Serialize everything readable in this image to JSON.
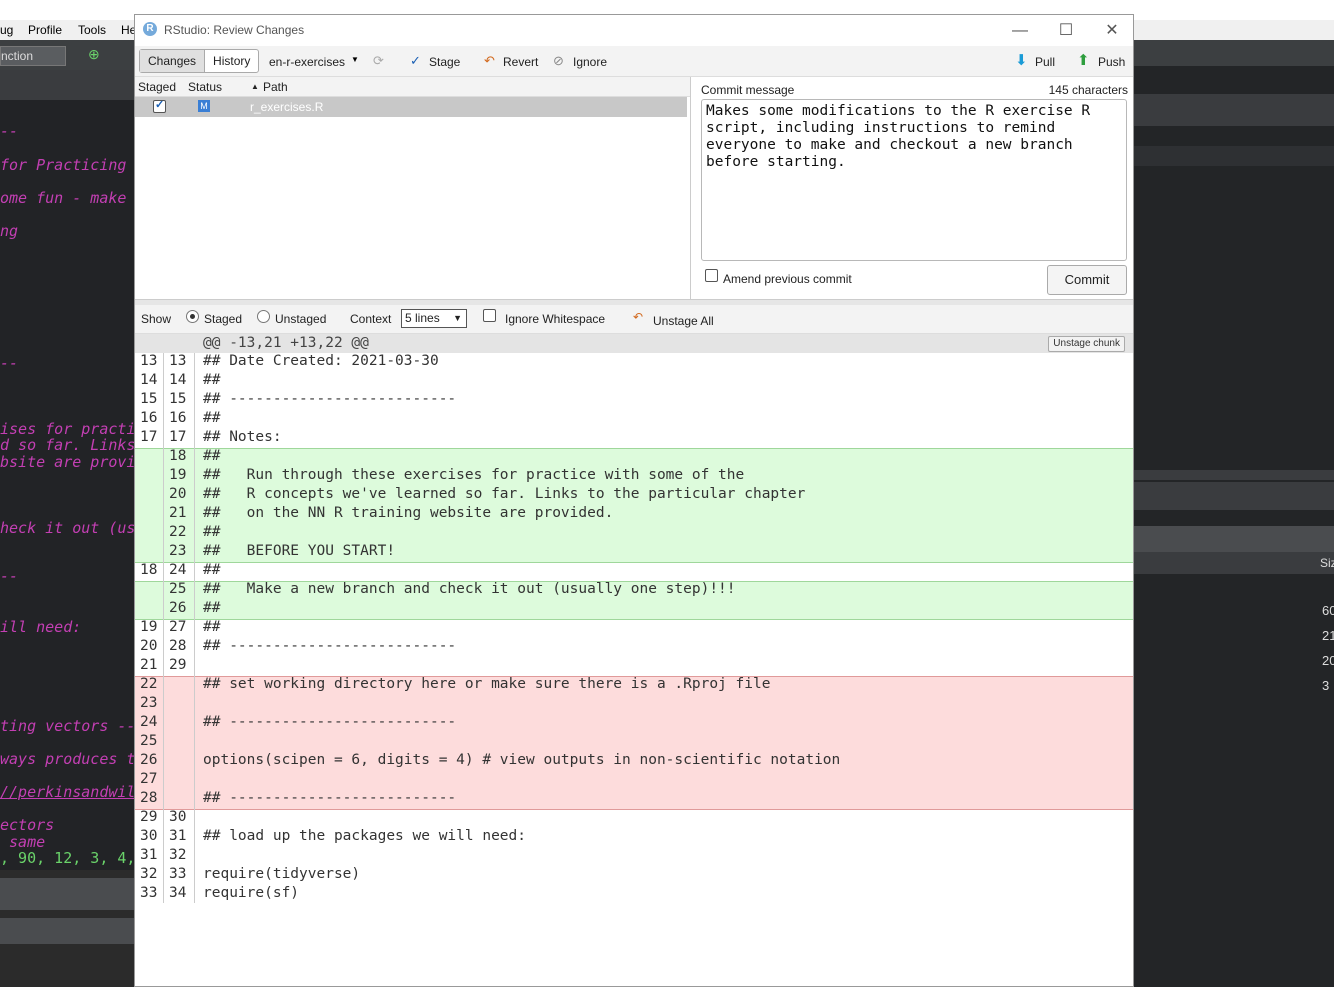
{
  "bg": {
    "menu": [
      "ug",
      "Profile",
      "Tools",
      "He"
    ],
    "fn_box": "nction",
    "editor_lines": [
      {
        "t": "--"
      },
      {
        "t": "for Practicing"
      },
      {
        "t": "ome fun - make"
      },
      {
        "t": "ng"
      },
      {
        "t": "--"
      },
      {
        "t": "ises for practi"
      },
      {
        "t": "d so far. Links"
      },
      {
        "t": "bsite are provi"
      },
      {
        "t": "heck it out (us"
      },
      {
        "t": "--"
      },
      {
        "t": "ill need:"
      },
      {
        "t": "ting vectors --"
      },
      {
        "t": "ways produces t"
      },
      {
        "t": "//perkinsandwil"
      },
      {
        "t": "ectors"
      },
      {
        "t": " same"
      }
    ],
    "editor_code_line": ", 90, 12, 3, 4,",
    "right_header": "Siz",
    "right_nums": [
      "60",
      "21",
      "20",
      "3"
    ]
  },
  "window": {
    "title": "RStudio: Review Changes",
    "controls": {
      "minimize": "—",
      "maximize": "☐",
      "close": "✕"
    }
  },
  "toolbar": {
    "tab_changes": "Changes",
    "tab_history": "History",
    "branch": "en-r-exercises",
    "stage": "Stage",
    "revert": "Revert",
    "ignore": "Ignore",
    "pull": "Pull",
    "push": "Push"
  },
  "files": {
    "headers": {
      "staged": "Staged",
      "status": "Status",
      "path": "Path"
    },
    "rows": [
      {
        "staged": true,
        "status": "M",
        "path": "r_exercises.R"
      }
    ]
  },
  "commit": {
    "label": "Commit message",
    "count": "145 characters",
    "message": "Makes some modifications to the R exercise R\nscript, including instructions to remind\neveryone to make and checkout a new branch\nbefore starting.",
    "amend": "Amend previous commit",
    "button": "Commit"
  },
  "options": {
    "show": "Show",
    "staged": "Staged",
    "unstaged": "Unstaged",
    "context": "Context",
    "context_value": "5 lines",
    "ignore_ws": "Ignore Whitespace",
    "unstage_all": "Unstage All"
  },
  "diff": {
    "hunk": "@@ -13,21 +13,22 @@",
    "unstage_chunk": "Unstage chunk",
    "lines": [
      {
        "o": "13",
        "n": "13",
        "c": "## Date Created: 2021-03-30",
        "k": "ctx"
      },
      {
        "o": "14",
        "n": "14",
        "c": "##",
        "k": "ctx"
      },
      {
        "o": "15",
        "n": "15",
        "c": "## --------------------------",
        "k": "ctx"
      },
      {
        "o": "16",
        "n": "16",
        "c": "##",
        "k": "ctx"
      },
      {
        "o": "17",
        "n": "17",
        "c": "## Notes:",
        "k": "ctx"
      },
      {
        "o": "",
        "n": "18",
        "c": "##",
        "k": "add"
      },
      {
        "o": "",
        "n": "19",
        "c": "##   Run through these exercises for practice with some of the",
        "k": "add"
      },
      {
        "o": "",
        "n": "20",
        "c": "##   R concepts we've learned so far. Links to the particular chapter",
        "k": "add"
      },
      {
        "o": "",
        "n": "21",
        "c": "##   on the NN R training website are provided.",
        "k": "add"
      },
      {
        "o": "",
        "n": "22",
        "c": "##",
        "k": "add"
      },
      {
        "o": "",
        "n": "23",
        "c": "##   BEFORE YOU START!",
        "k": "add"
      },
      {
        "o": "18",
        "n": "24",
        "c": "##",
        "k": "ctx"
      },
      {
        "o": "",
        "n": "25",
        "c": "##   Make a new branch and check it out (usually one step)!!!",
        "k": "add"
      },
      {
        "o": "",
        "n": "26",
        "c": "##",
        "k": "add"
      },
      {
        "o": "19",
        "n": "27",
        "c": "##",
        "k": "ctx"
      },
      {
        "o": "20",
        "n": "28",
        "c": "## --------------------------",
        "k": "ctx"
      },
      {
        "o": "21",
        "n": "29",
        "c": "",
        "k": "ctx"
      },
      {
        "o": "22",
        "n": "",
        "c": "## set working directory here or make sure there is a .Rproj file",
        "k": "del"
      },
      {
        "o": "23",
        "n": "",
        "c": "",
        "k": "del"
      },
      {
        "o": "24",
        "n": "",
        "c": "## --------------------------",
        "k": "del"
      },
      {
        "o": "25",
        "n": "",
        "c": "",
        "k": "del"
      },
      {
        "o": "26",
        "n": "",
        "c": "options(scipen = 6, digits = 4) # view outputs in non-scientific notation",
        "k": "del"
      },
      {
        "o": "27",
        "n": "",
        "c": "",
        "k": "del"
      },
      {
        "o": "28",
        "n": "",
        "c": "## --------------------------",
        "k": "del"
      },
      {
        "o": "29",
        "n": "30",
        "c": "",
        "k": "ctx"
      },
      {
        "o": "30",
        "n": "31",
        "c": "## load up the packages we will need:",
        "k": "ctx"
      },
      {
        "o": "31",
        "n": "32",
        "c": "",
        "k": "ctx"
      },
      {
        "o": "32",
        "n": "33",
        "c": "require(tidyverse)",
        "k": "ctx"
      },
      {
        "o": "33",
        "n": "34",
        "c": "require(sf)",
        "k": "ctx"
      }
    ]
  }
}
